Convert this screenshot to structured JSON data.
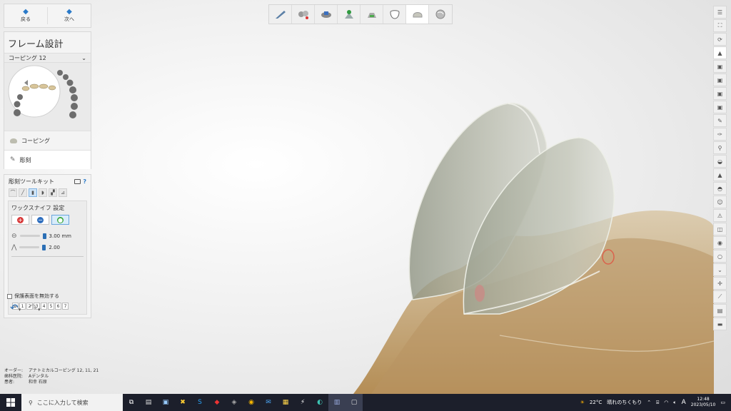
{
  "nav": {
    "back_label": "戻る",
    "next_label": "次へ"
  },
  "design": {
    "title": "フレーム設計",
    "dropdown_value": "コーピング 12",
    "steps": [
      {
        "label": "コーピング"
      },
      {
        "label": "彫刻"
      }
    ]
  },
  "toolkit": {
    "title": "彫刻ツールキット",
    "help": "?",
    "wax_title": "ワックスナイフ 設定",
    "size_value": "3.00 mm",
    "strength_value": "2.00",
    "numbers": [
      "1",
      "2",
      "3",
      "4",
      "5",
      "6",
      "7"
    ],
    "checkbox_label": "保護表面を無効する"
  },
  "info": {
    "order_key": "オーダー:",
    "order_value": "アナトミカルコーピング 12, 11, 21",
    "lab_key": "歯科医院:",
    "lab_value": "Aデンタル",
    "patient_key": "患者:",
    "patient_value": "和幸 石原"
  },
  "taskbar": {
    "search_placeholder": "ここに入力して検索",
    "weather_temp": "22°C",
    "weather_text": "晴れのちくもり",
    "ime": "A",
    "time": "12:48",
    "date": "2023/05/10"
  },
  "colors": {
    "accent": "#2a7ac9",
    "gum": "#c9a877",
    "tooth": "#a9ad9c",
    "taskbar": "#1c1f2b"
  }
}
